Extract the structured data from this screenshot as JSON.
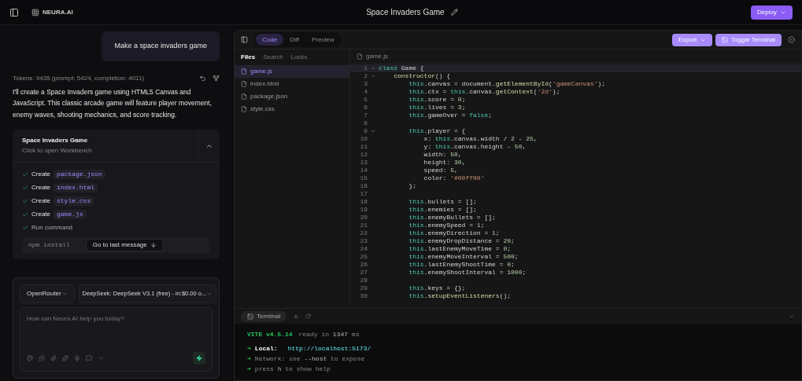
{
  "top_bar": {
    "brand": "NEURA.AI",
    "title": "Space Invaders Game",
    "deploy": "Deploy"
  },
  "chat": {
    "user_message": "Make a space invaders game",
    "tokens": "Tokens: 9435 (prompt: 5424, completion: 4011)",
    "reply": "I'll create a Space Invaders game using HTML5 Canvas and JavaScript. This classic arcade game will feature player movement, enemy waves, shooting mechanics, and score tracking.",
    "artifact": {
      "title": "Space Invaders Game",
      "subtitle": "Click to open Workbench",
      "expanded": true
    },
    "steps": [
      {
        "label": "Create",
        "file": "package.json",
        "done": true
      },
      {
        "label": "Create",
        "file": "index.html",
        "done": true
      },
      {
        "label": "Create",
        "file": "style.css",
        "done": true
      },
      {
        "label": "Create",
        "file": "game.js",
        "done": true
      },
      {
        "label": "Run command",
        "done": true
      }
    ],
    "command": "npm install",
    "jump_button": "Go to last message"
  },
  "composer": {
    "provider": "OpenRouter",
    "model": "DeepSeek: DeepSeek V3.1 (free) - in:$0.00 o...",
    "placeholder": "How can Neura.AI help you today?"
  },
  "workbench": {
    "tabs": [
      {
        "label": "Code",
        "selected": true
      },
      {
        "label": "Diff",
        "selected": false
      },
      {
        "label": "Preview",
        "selected": false
      }
    ],
    "export": "Export",
    "toggle_terminal": "Toggle Terminal",
    "file_tabs": [
      {
        "label": "Files",
        "selected": true
      },
      {
        "label": "Search",
        "selected": false
      },
      {
        "label": "Locks",
        "selected": false
      }
    ],
    "files": [
      {
        "name": "game.js",
        "selected": true
      },
      {
        "name": "index.html",
        "selected": false
      },
      {
        "name": "package.json",
        "selected": false
      },
      {
        "name": "style.css",
        "selected": false
      }
    ],
    "open_file": "game.js",
    "code_lines": [
      {
        "n": "1",
        "text": "class Game {",
        "fold": true
      },
      {
        "n": "2",
        "text": "    constructor() {",
        "fold": true
      },
      {
        "n": "3",
        "text": "        this.canvas = document.getElementById('gameCanvas');",
        "fold": false
      },
      {
        "n": "4",
        "text": "        this.ctx = this.canvas.getContext('2d');",
        "fold": false
      },
      {
        "n": "5",
        "text": "        this.score = 0;",
        "fold": false
      },
      {
        "n": "6",
        "text": "        this.lives = 3;",
        "fold": false
      },
      {
        "n": "7",
        "text": "        this.gameOver = false;",
        "fold": false
      },
      {
        "n": "8",
        "fold": false
      },
      {
        "n": "9",
        "text": "        this.player = {",
        "fold": true
      },
      {
        "n": "10",
        "text": "            x: this.canvas.width / 2 - 25,",
        "fold": false
      },
      {
        "n": "11",
        "text": "            y: this.canvas.height - 50,",
        "fold": false
      },
      {
        "n": "12",
        "text": "            width: 50,",
        "fold": false
      },
      {
        "n": "13",
        "text": "            height: 30,",
        "fold": false
      },
      {
        "n": "14",
        "text": "            speed: 5,",
        "fold": false
      },
      {
        "n": "15",
        "text": "            color: '#00ff00'",
        "fold": false
      },
      {
        "n": "16",
        "text": "        };",
        "fold": false
      },
      {
        "n": "17",
        "fold": false
      },
      {
        "n": "18",
        "text": "        this.bullets = [];",
        "fold": false
      },
      {
        "n": "19",
        "text": "        this.enemies = [];",
        "fold": false
      },
      {
        "n": "20",
        "text": "        this.enemyBullets = [];",
        "fold": false
      },
      {
        "n": "21",
        "text": "        this.enemySpeed = 1;",
        "fold": false
      },
      {
        "n": "22",
        "text": "        this.enemyDirection = 1;",
        "fold": false
      },
      {
        "n": "23",
        "text": "        this.enemyDropDistance = 20;",
        "fold": false
      },
      {
        "n": "24",
        "text": "        this.lastEnemyMoveTime = 0;",
        "fold": false
      },
      {
        "n": "25",
        "text": "        this.enemyMoveInterval = 500;",
        "fold": false
      },
      {
        "n": "26",
        "text": "        this.lastEnemyShootTime = 0;",
        "fold": false
      },
      {
        "n": "27",
        "text": "        this.enemyShootInterval = 1000;",
        "fold": false
      },
      {
        "n": "28",
        "fold": false
      },
      {
        "n": "29",
        "text": "        this.keys = {};",
        "fold": false
      },
      {
        "n": "30",
        "text": "        this.setupEventListeners();",
        "fold": false
      }
    ],
    "terminal_tab": "Terminal",
    "terminal": {
      "vite": "VITE v4.5.14",
      "ready": "ready in **1347** ms",
      "lines": [
        {
          "arrow": "➜",
          "label": "Local:",
          "value": "http://localhost:5173/",
          "kind": "link"
        },
        {
          "arrow": "➜",
          "label": "Network:",
          "value": "use **--host** to expose",
          "kind": "hint"
        },
        {
          "arrow": "➜",
          "value": "press **h** to show help",
          "kind": "hint"
        }
      ]
    }
  }
}
